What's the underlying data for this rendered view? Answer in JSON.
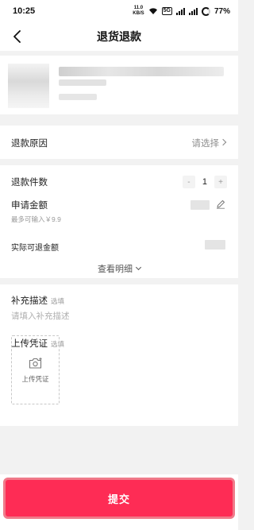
{
  "status_bar": {
    "time": "10:25",
    "net_speed_value": "11.0",
    "net_speed_unit": "KB/S",
    "network_badge": "5G",
    "battery": "77%"
  },
  "nav": {
    "title": "退货退款",
    "back_icon": "chevron-left-icon"
  },
  "refund_reason": {
    "label": "退款原因",
    "value": "请选择"
  },
  "refund_qty": {
    "label": "退款件数",
    "minus": "-",
    "value": "1",
    "plus": "+"
  },
  "apply_amount": {
    "label": "申请金额",
    "hint": "最多可输入￥9.9",
    "edit_icon": "pencil-icon"
  },
  "actual_refund": {
    "label": "实际可退金额"
  },
  "view_details": {
    "label": "查看明细"
  },
  "supplement": {
    "label": "补充描述",
    "optional": "选填",
    "placeholder": "请填入补充描述"
  },
  "upload": {
    "label": "上传凭证",
    "optional": "选填",
    "box_label": "上传凭证",
    "icon": "camera-plus-icon"
  },
  "submit": {
    "label": "提交",
    "color": "#fe2c55"
  }
}
